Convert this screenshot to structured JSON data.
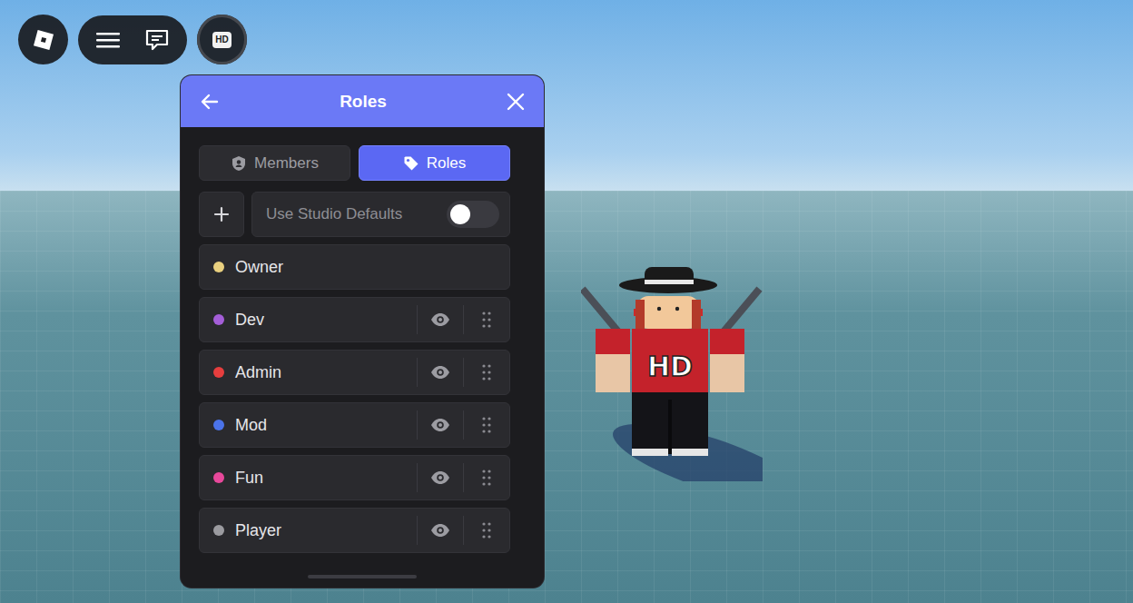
{
  "topbar": {
    "hd_button": {
      "label": "HD"
    }
  },
  "window": {
    "title": "Roles"
  },
  "tabs": [
    {
      "label": "Members",
      "selected": false
    },
    {
      "label": "Roles",
      "selected": true
    }
  ],
  "toggle": {
    "label": "Use Studio Defaults",
    "on": false
  },
  "roles": [
    {
      "name": "Owner",
      "color": "#e9d07f",
      "kind": "fixed"
    },
    {
      "name": "Dev",
      "color": "#a45ed8",
      "kind": "editable"
    },
    {
      "name": "Admin",
      "color": "#e63e3e",
      "kind": "editable"
    },
    {
      "name": "Mod",
      "color": "#4b73e9",
      "kind": "editable"
    },
    {
      "name": "Fun",
      "color": "#e8489b",
      "kind": "editable"
    },
    {
      "name": "Player",
      "color": "#9b9ba0",
      "kind": "editable"
    }
  ],
  "character": {
    "shirt_text": "HD"
  }
}
